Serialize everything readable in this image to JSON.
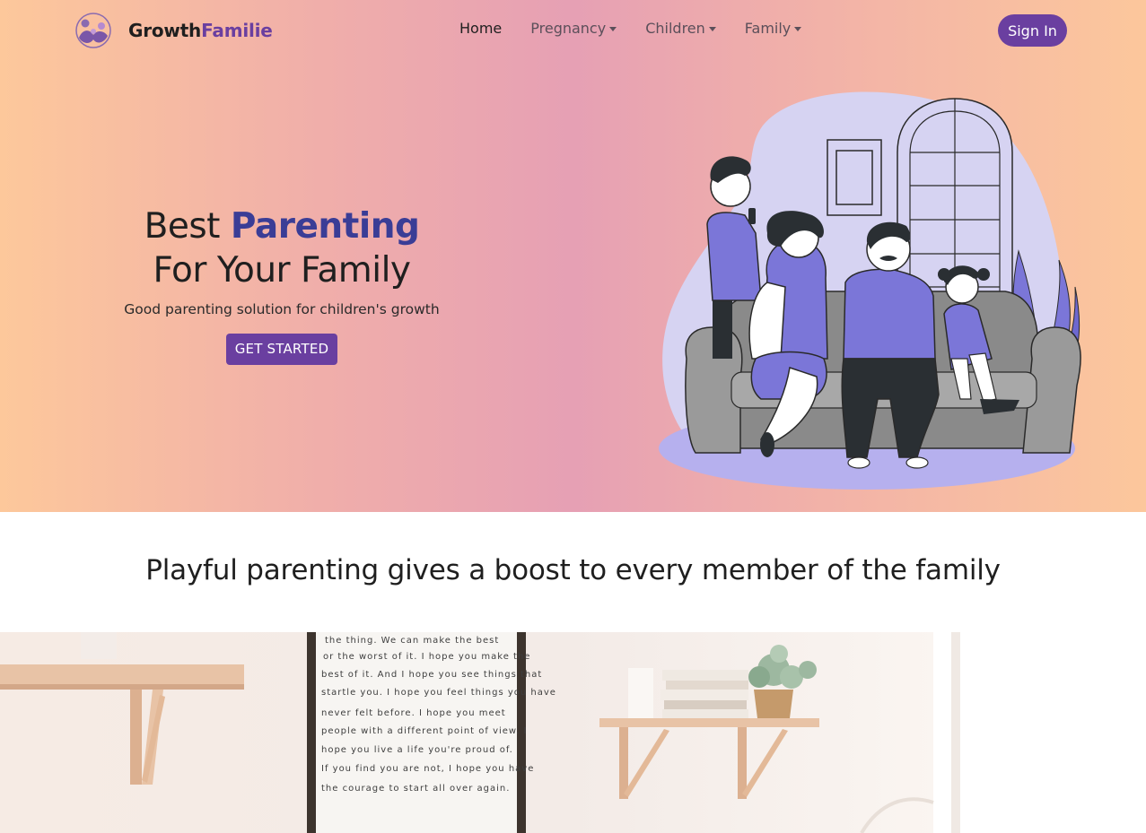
{
  "navbar": {
    "brand_part1": "Growth",
    "brand_part2": "Familie",
    "links": [
      "Home",
      "Pregnancy",
      "Children",
      "Family"
    ],
    "signin_label": "Sign In"
  },
  "hero": {
    "headline_pre": "Best ",
    "headline_accent": "Parenting",
    "headline_line2": "For Your Family",
    "subtitle": "Good parenting solution for children's growth",
    "cta_label": "GET STARTED"
  },
  "section": {
    "title": "Playful parenting gives a boost to every member of the family"
  },
  "photo": {
    "sign_lines": [
      "the thing. We can make the best",
      "or the worst of it. I hope you make the",
      "best of it. And I hope you see things that",
      "startle you. I hope you feel things you have",
      "never felt before. I hope you meet",
      "people with a different point of view. I",
      "hope you live a life you're proud of.",
      "If you find you are not, I hope you have",
      "the courage to start all over again."
    ]
  },
  "icons": {
    "logo": "family-hug-logo-icon",
    "dropdown": "caret-down-icon"
  },
  "colors": {
    "accent_purple": "#6a3fa0",
    "accent_blue": "#3a3d96",
    "hero_gradient": [
      "#fdc89b",
      "#e6a0b4",
      "#fcc79c"
    ],
    "illustration_bg": "#d6d3f2",
    "illustration_fill": "#7b76d8"
  }
}
